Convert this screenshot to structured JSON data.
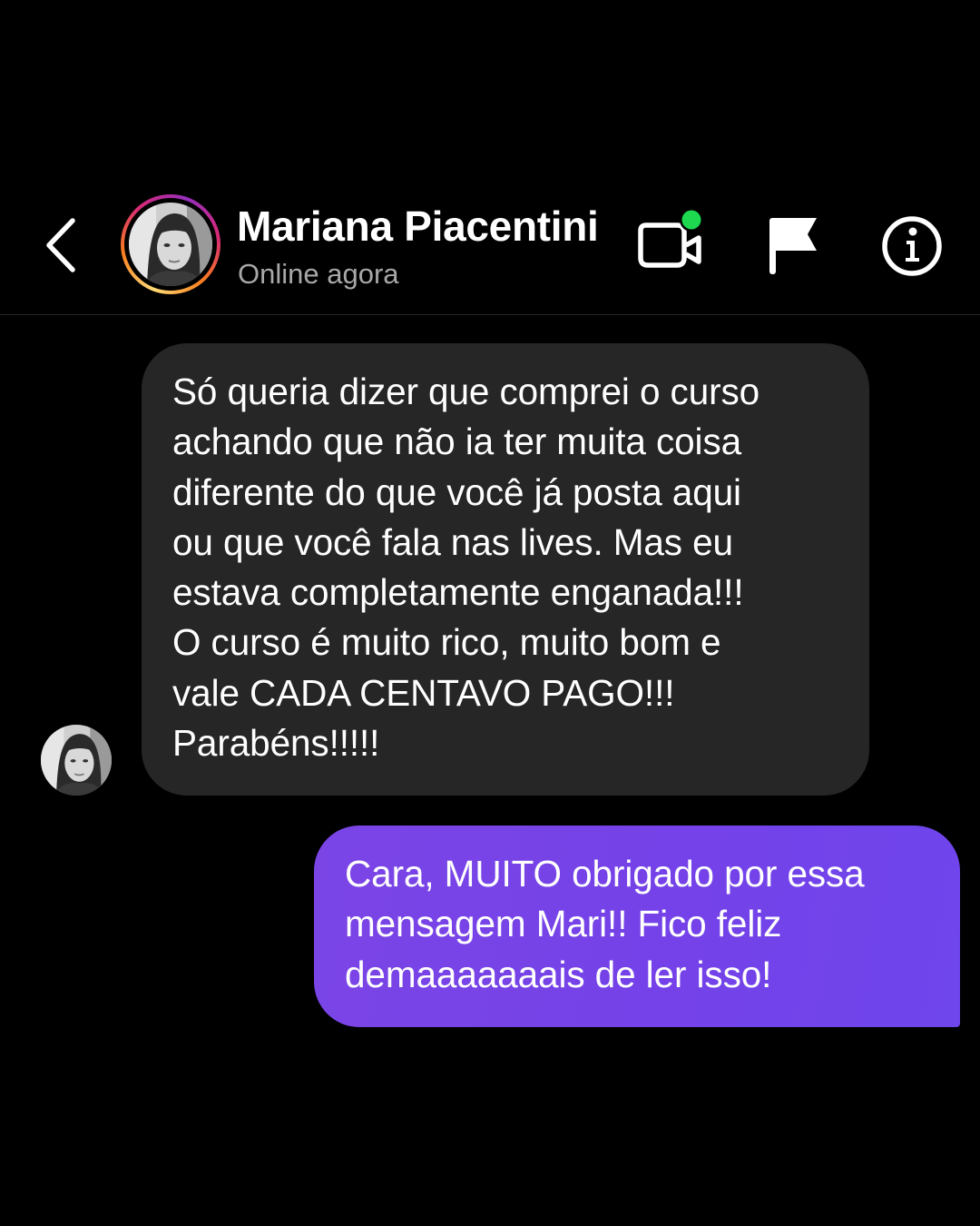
{
  "header": {
    "contact_name": "Mariana Piacentini",
    "status": "Online agora",
    "back_icon": "chevron-left-icon",
    "video_icon": "video-call-icon",
    "flag_icon": "flag-icon",
    "info_icon": "info-icon",
    "online_dot_color": "#1ed94f"
  },
  "messages": [
    {
      "direction": "incoming",
      "text": "Só queria dizer que comprei o curso\nachando que não ia ter muita coisa\ndiferente do que você já posta aqui\nou que você fala nas lives. Mas eu\nestava completamente enganada!!!\nO curso é muito rico, muito bom e\nvale CADA CENTAVO PAGO!!!\nParabéns!!!!!",
      "bubble_color": "#262626"
    },
    {
      "direction": "outgoing",
      "text": "Cara, MUITO obrigado por essa\nmensagem Mari!! Fico feliz\ndemaaaaaaais de ler isso!",
      "bubble_color": "#7442e8"
    }
  ],
  "colors": {
    "background": "#000000",
    "status_text": "#a8a8a8",
    "divider": "#262626"
  }
}
